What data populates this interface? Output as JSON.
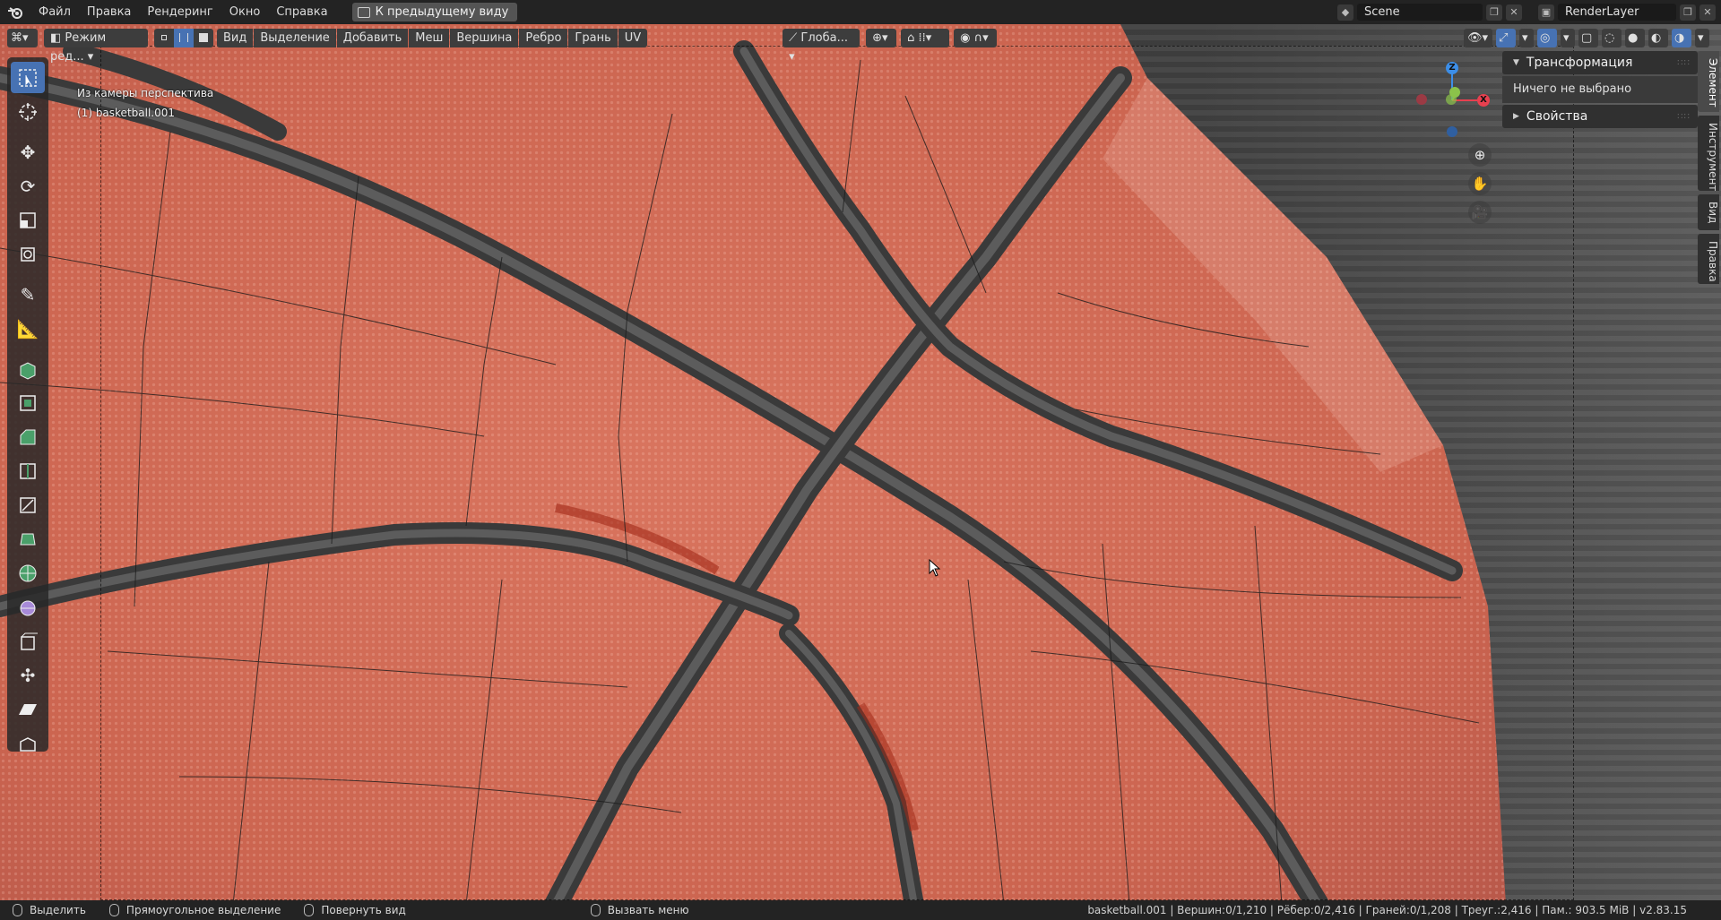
{
  "menu": {
    "items": [
      "Файл",
      "Правка",
      "Рендеринг",
      "Окно",
      "Справка"
    ],
    "back_button": "К предыдущему виду"
  },
  "top_right": {
    "scene": "Scene",
    "render_layer": "RenderLayer"
  },
  "header": {
    "mode": "Режим ред...",
    "menus": [
      "Вид",
      "Выделение",
      "Добавить",
      "Меш",
      "Вершина",
      "Ребро",
      "Грань",
      "UV"
    ],
    "orientation": "Глоба..."
  },
  "viewport": {
    "view_name": "Из камеры перспектива",
    "object_name": "(1) basketball.001"
  },
  "gizmo": {
    "z": "Z",
    "x": "X"
  },
  "npanel": {
    "transform_title": "Трансформация",
    "nothing_selected": "Ничего не выбрано",
    "properties_title": "Свойства"
  },
  "side_tabs": [
    "Элемент",
    "Инструмент",
    "Вид",
    "Правка"
  ],
  "statusbar": {
    "select": "Выделить",
    "box_select": "Прямоугольное выделение",
    "rotate_view": "Повернуть вид",
    "call_menu": "Вызвать меню",
    "stats": "basketball.001 | Вершин:0/1,210 | Рёбер:0/2,416 | Граней:0/1,208 | Треуг.:2,416 | Пам.: 903.5 MiB | v2.83.15"
  },
  "colors": {
    "accent": "#4772b3",
    "ball": "#d26a55",
    "seam": "#3c3c3c",
    "axis_x": "#e8404f",
    "axis_y": "#8bc34a",
    "axis_z": "#3c8ee8"
  }
}
